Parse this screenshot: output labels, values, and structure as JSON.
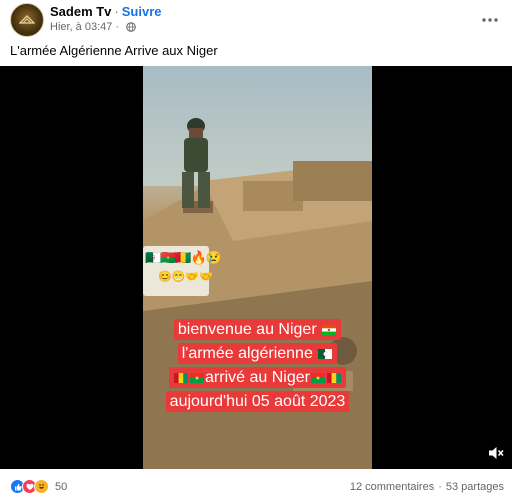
{
  "post": {
    "page_name": "Sadem Tv",
    "separator": "·",
    "follow_label": "Suivre",
    "timestamp": "Hier, à 03:47",
    "meta_separator": "·",
    "caption": "L'armée Algérienne Arrive aux Niger"
  },
  "video": {
    "overlay_lines": [
      "bienvenue au Niger",
      "l'armée algérienne",
      "arrivé au Niger",
      "aujourd'hui 05 août 2023"
    ],
    "sticker_emojis": "🇩🇿🇧🇫🇬🇳🔥😢",
    "sticker_emojis_2": "😊😁🤝🤝"
  },
  "footer": {
    "reaction_count": "50",
    "comments": "12 commentaires",
    "separator": "·",
    "shares": "53 partages"
  },
  "colors": {
    "link_blue": "#1b74e4",
    "overlay_red": "#e93a3a",
    "secondary_text": "#65676b"
  },
  "icons": {
    "globe": "globe-icon",
    "more": "more-horizontal-icon",
    "volume": "volume-muted-icon"
  }
}
